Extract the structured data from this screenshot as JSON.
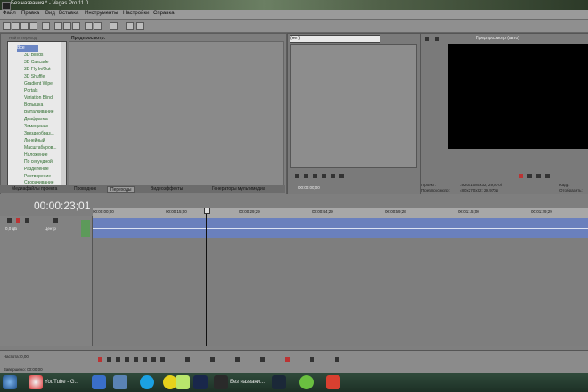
{
  "window": {
    "title": "Без названия * - Vegas Pro 11.0"
  },
  "menu": [
    "Файл",
    "Правка",
    "Вид",
    "Вставка",
    "Инструменты",
    "Настройки",
    "Справка"
  ],
  "browser": {
    "search_hint": "Найти переход",
    "label": "Предпросмотр:",
    "root": "Все",
    "items": [
      "3D Blinds",
      "3D Cascade",
      "3D Fly In/Out",
      "3D Shuffle",
      "Gradient Wipe",
      "Portals",
      "Variation Blind",
      "Вспышка",
      "Выталкивание",
      "Диафрагма",
      "Замещение",
      "Звездообраз...",
      "Линейный",
      "Масштабиров...",
      "Наложение",
      "По секундной",
      "Разделение",
      "Растворение",
      "Сворачивание"
    ]
  },
  "tabs": [
    "Медиафайлы проекта",
    "Проводник",
    "Переходы",
    "Видеоэффекты",
    "Генераторы мультимедиа"
  ],
  "active_tab": 2,
  "trimmer": {
    "dropdown": "(нет)",
    "timecode": "00:00:00;00"
  },
  "preview": {
    "label": "Предпросмотр (авто)",
    "project_label": "Проект:",
    "project_value": "1920x1080x32; 29,970i",
    "preview_label": "Предпросмотр:",
    "preview_value": "480x270x32; 29,970p",
    "frame_label": "Кадр:",
    "display_label": "Отобразить:"
  },
  "timeline": {
    "timecode": "00:00:23;01",
    "ruler": [
      "00:00:00;00",
      "00:00:15;00",
      "00:00:29;29",
      "00:00:44;29",
      "00:00:59;28",
      "00:01:15;00",
      "00:01:29;29"
    ],
    "track": {
      "volume": "0,0 дБ",
      "pan": "Центр"
    }
  },
  "status": {
    "rate": "Частота: 0,00",
    "record": "Завершено: 00:00:00"
  },
  "taskbar": {
    "youtube": "YouTube - G...",
    "vegas": "Без названи..."
  },
  "colors": {
    "track": "#6a80bd",
    "preview_bg": "#000000",
    "taskbar": "#1d3025"
  }
}
